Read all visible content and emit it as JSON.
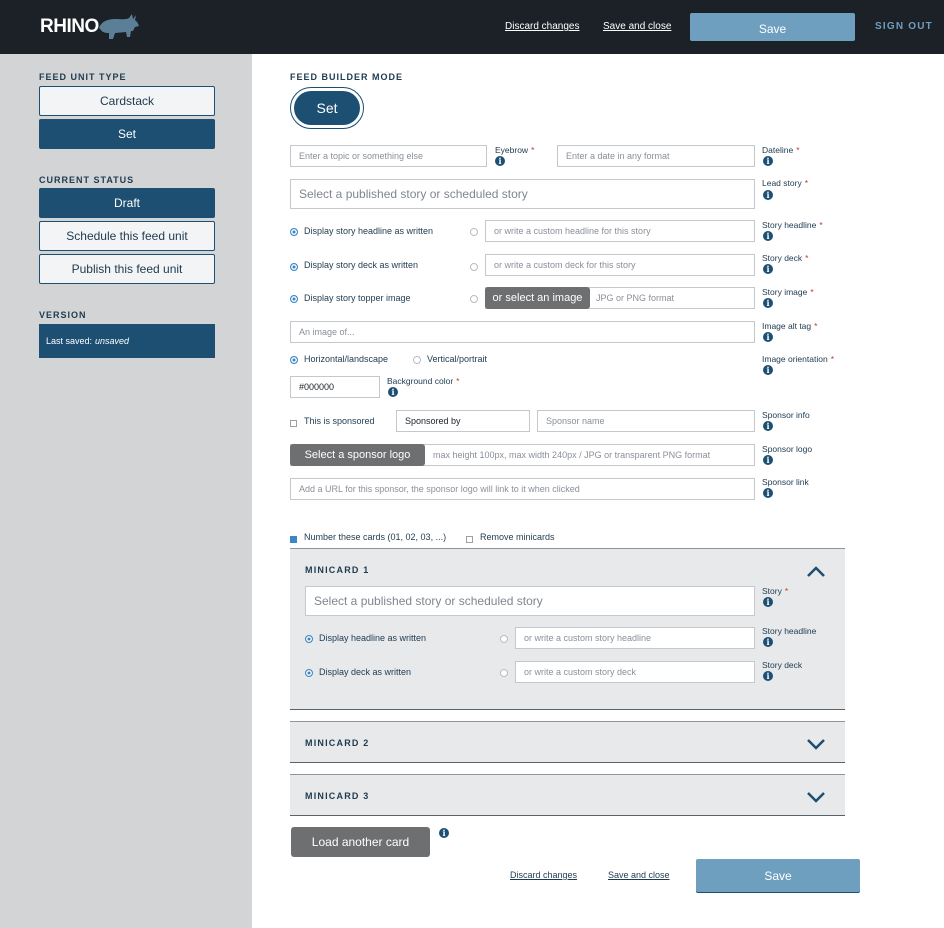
{
  "app": {
    "logo_text": "RHINO"
  },
  "topbar": {
    "discard_label": "Discard changes",
    "save_close_label": "Save and close",
    "save_label": "Save",
    "signout_label": "SIGN OUT"
  },
  "sidebar": {
    "feed_unit_type_heading": "FEED UNIT TYPE",
    "types": [
      {
        "label": "Cardstack",
        "active": false
      },
      {
        "label": "Set",
        "active": true
      }
    ],
    "status_heading": "CURRENT STATUS",
    "statuses": [
      {
        "label": "Draft",
        "active": true
      },
      {
        "label": "Schedule this feed unit",
        "active": false
      },
      {
        "label": "Publish this feed unit",
        "active": false
      }
    ],
    "version_heading": "VERSION",
    "last_saved_label": "Last saved:",
    "last_saved_value": "unsaved"
  },
  "main": {
    "mode_heading": "FEED BUILDER MODE",
    "mode_value": "Set",
    "eyebrow": {
      "placeholder": "Enter a topic or something else",
      "label": "Eyebrow"
    },
    "dateline": {
      "placeholder": "Enter a date in any format",
      "label": "Dateline"
    },
    "lead_story": {
      "placeholder": "Select a published story or scheduled story",
      "label": "Lead story"
    },
    "headline": {
      "option_label": "Display story headline as written",
      "placeholder": "or write a custom headline for this story",
      "label": "Story headline"
    },
    "deck": {
      "option_label": "Display story deck as written",
      "placeholder": "or write a custom deck for this story",
      "label": "Story deck"
    },
    "image": {
      "option_label": "Display story topper image",
      "button_label": "or select an image",
      "placeholder": "JPG or PNG format",
      "label": "Story image"
    },
    "alt_tag": {
      "placeholder": "An image of...",
      "label": "Image alt tag"
    },
    "orientation": {
      "horizontal_label": "Horizontal/landscape",
      "vertical_label": "Vertical/portrait",
      "label": "Image orientation",
      "selected": "Horizontal/landscape"
    },
    "background": {
      "value": "#000000",
      "label": "Background color"
    },
    "sponsor": {
      "checkbox_label": "This is sponsored",
      "sponsored_by_value": "Sponsored by",
      "name_placeholder": "Sponsor name",
      "info_label": "Sponsor info",
      "logo_button_label": "Select a sponsor logo",
      "logo_placeholder": "max height 100px, max width 240px / JPG or transparent PNG format",
      "logo_label": "Sponsor logo",
      "link_placeholder": "Add a URL for this sponsor, the sponsor logo will link to it when clicked",
      "link_label": "Sponsor link"
    },
    "number_cards_label": "Number these cards (01, 02, 03, ...)",
    "number_cards_checked": true,
    "remove_minicards_label": "Remove minicards",
    "remove_minicards_checked": false,
    "minicards": [
      {
        "title": "MINICARD 1",
        "expanded": true,
        "story_placeholder": "Select a published story or scheduled story",
        "story_label": "Story",
        "headline_option_label": "Display headline as written",
        "headline_placeholder": "or write a custom story headline",
        "headline_label": "Story headline",
        "deck_option_label": "Display deck as written",
        "deck_placeholder": "or write a custom story deck",
        "deck_label": "Story deck"
      },
      {
        "title": "MINICARD 2",
        "expanded": false
      },
      {
        "title": "MINICARD 3",
        "expanded": false
      }
    ],
    "load_card_label": "Load another card",
    "discard_label": "Discard changes",
    "save_close_label": "Save and close",
    "save_label": "Save"
  },
  "colors": {
    "topbar": "#1b2126",
    "sidebar": "#d3d4d5",
    "primary": "#1d4f73",
    "save_button": "#6f9fbf",
    "gray_button": "#6e6f70",
    "minicard_bg": "#e8e9eb",
    "required": "#c0392b",
    "radio_selected": "#3a86c6"
  },
  "icons": [
    "rhino-logo",
    "info-icon",
    "chevron-up-icon",
    "chevron-down-icon",
    "radio-icon",
    "checkbox-icon"
  ]
}
